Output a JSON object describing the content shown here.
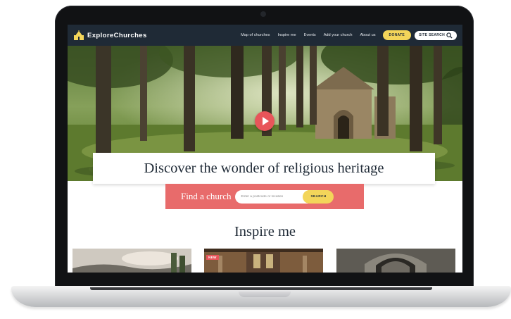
{
  "site": {
    "logo_text": "ExploreChurches"
  },
  "nav": {
    "links": [
      "Map of churches",
      "Inspire me",
      "Events",
      "Add your church",
      "About us"
    ],
    "donate_label": "DONATE",
    "site_search_label": "SITE SEARCH"
  },
  "hero": {
    "headline": "Discover the wonder of religious heritage"
  },
  "find": {
    "label": "Find a church",
    "placeholder": "Enter a postcode or location",
    "search_label": "SEARCH"
  },
  "inspire": {
    "title": "Inspire me",
    "cards": [
      {
        "badge": ""
      },
      {
        "badge": "NEW"
      },
      {
        "badge": ""
      }
    ]
  },
  "colors": {
    "nav_bg": "#1f2a36",
    "accent_yellow": "#f3d55a",
    "accent_coral": "#e86b6b",
    "play_red": "#e8555a"
  },
  "icons": {
    "logo": "church-icon",
    "search": "search-icon",
    "play": "play-icon"
  }
}
